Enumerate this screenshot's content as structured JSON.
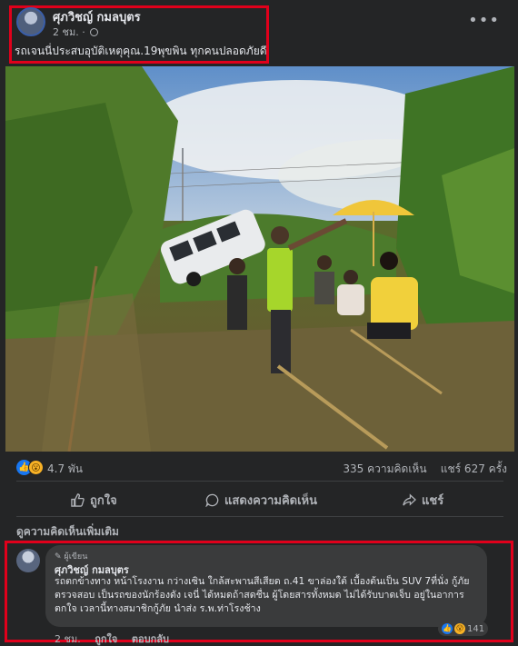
{
  "post": {
    "author": "ศุภวิชญ์ กมลบุตร",
    "time": "2 ชม.",
    "caption": "รถเจนนี่ประสบอุบัติเหตุคุณ.19พุขพิน   ทุกคนปลอดภัยดี",
    "more_label": "•••"
  },
  "stats": {
    "reaction_count": "4.7 พัน",
    "comments": "335 ความคิดเห็น",
    "shares": "แชร์ 627 ครั้ง"
  },
  "actions": {
    "like": "ถูกใจ",
    "comment": "แสดงความคิดเห็น",
    "share": "แชร์"
  },
  "more_comments": "ดูความคิดเห็นเพิ่มเติม",
  "comment": {
    "badge": "ผู้เขียน",
    "author": "ศุภวิชญ์ กมลบุตร",
    "text": "รถตกข้างทาง หน้าโรงงาน กว่างเซิน ใกล้สะพานสีเสียด ถ.41 ขาล่องใต้ เบื้องต้นเป็น SUV 7ที่นั่ง กู้ภัยตรวจสอบ เป็นรถของนักร้องดัง เจนี่ ได้หมดถ้าสดชื่น ผู้โดยสารทั้งหมด ไม่ได้รับบาดเจ็บ อยู่ในอาการตกใจ เวลานี้ทางสมาชิกกู้ภัย นำส่ง ร.พ.ท่าโรงช้าง",
    "reaction_count": "141",
    "time": "2 ชม.",
    "like": "ถูกใจ",
    "reply": "ตอบกลับ"
  },
  "icons": [
    "globe-icon",
    "like-icon",
    "comment-icon",
    "share-icon",
    "pencil-icon",
    "wow-icon"
  ],
  "colors": {
    "highlight_border": "#e0001b",
    "like_blue": "#1877f2",
    "card_bg": "#242526"
  }
}
